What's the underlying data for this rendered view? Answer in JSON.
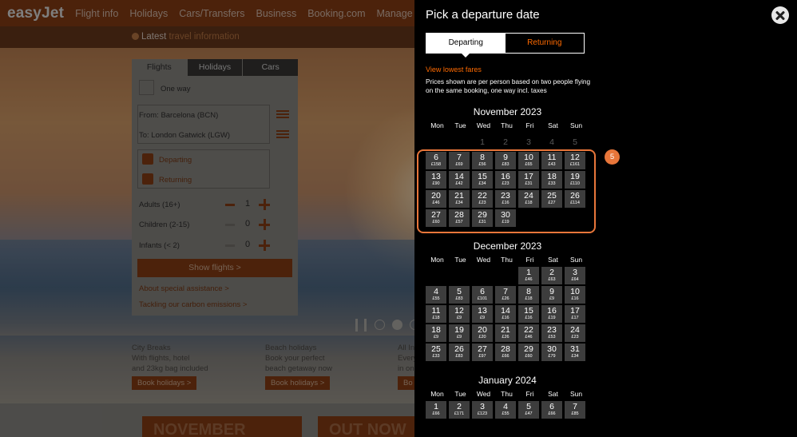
{
  "header": {
    "logo": "easyJet",
    "nav": [
      "Flight info",
      "Holidays",
      "Cars/Transfers",
      "Business",
      "Booking.com",
      "Manage Bookin"
    ]
  },
  "infobar": {
    "prefix": "Latest",
    "link": "travel information"
  },
  "search": {
    "tabs": [
      "Flights",
      "Holidays",
      "Cars"
    ],
    "one_way": "One way",
    "from": "From:  Barcelona (BCN)",
    "to": "To:  London Gatwick (LGW)",
    "departing": "Departing",
    "returning": "Returning",
    "passengers": [
      {
        "label": "Adults (16+)",
        "value": "1"
      },
      {
        "label": "Children (2-15)",
        "value": "0"
      },
      {
        "label": "Infants (< 2)",
        "value": "0"
      }
    ],
    "show_button": "Show flights >",
    "links": [
      "About special assistance >",
      "Tackling our carbon emissions >"
    ]
  },
  "promos": [
    {
      "title": "City Breaks",
      "line1": "With flights, hotel",
      "line2": "and 23kg bag included",
      "button": "Book holidays >"
    },
    {
      "title": "Beach holidays",
      "line1": "Book your perfect",
      "line2": "beach getaway now",
      "button": "Book holidays >"
    },
    {
      "title": "All In",
      "line1": "Every",
      "line2": "in one",
      "button": "Bo"
    }
  ],
  "bottom_cards": [
    "NOVEMBER",
    "OUT NOW"
  ],
  "modal": {
    "title": "Pick a departure date",
    "toggle": {
      "departing": "Departing",
      "returning": "Returning"
    },
    "lowest_fares": "View lowest fares",
    "note": "Prices shown are per person based on two people flying on the same booking, one way incl. taxes",
    "step_badge": "5",
    "weekdays": [
      "Mon",
      "Tue",
      "Wed",
      "Thu",
      "Fri",
      "Sat",
      "Sun"
    ],
    "months": [
      {
        "name": "November 2023",
        "leading": [
          "",
          "",
          "1",
          "2",
          "3",
          "4",
          "5"
        ],
        "days": [
          {
            "d": "6",
            "p": "£158"
          },
          {
            "d": "7",
            "p": "£69"
          },
          {
            "d": "8",
            "p": "£56"
          },
          {
            "d": "9",
            "p": "£83"
          },
          {
            "d": "10",
            "p": "£65"
          },
          {
            "d": "11",
            "p": "£43"
          },
          {
            "d": "12",
            "p": "£161"
          },
          {
            "d": "13",
            "p": "£90"
          },
          {
            "d": "14",
            "p": "£42"
          },
          {
            "d": "15",
            "p": "£34"
          },
          {
            "d": "16",
            "p": "£23"
          },
          {
            "d": "17",
            "p": "£31"
          },
          {
            "d": "18",
            "p": "£33"
          },
          {
            "d": "19",
            "p": "£110"
          },
          {
            "d": "20",
            "p": "£46"
          },
          {
            "d": "21",
            "p": "£34"
          },
          {
            "d": "22",
            "p": "£23"
          },
          {
            "d": "23",
            "p": "£16"
          },
          {
            "d": "24",
            "p": "£18"
          },
          {
            "d": "25",
            "p": "£27"
          },
          {
            "d": "26",
            "p": "£114"
          },
          {
            "d": "27",
            "p": "£60"
          },
          {
            "d": "28",
            "p": "£57"
          },
          {
            "d": "29",
            "p": "£31"
          },
          {
            "d": "30",
            "p": "£19"
          }
        ]
      },
      {
        "name": "December 2023",
        "offset": 4,
        "days": [
          {
            "d": "1",
            "p": "£46"
          },
          {
            "d": "2",
            "p": "£63"
          },
          {
            "d": "3",
            "p": "£64"
          },
          {
            "d": "4",
            "p": "£55"
          },
          {
            "d": "5",
            "p": "£83"
          },
          {
            "d": "6",
            "p": "£101"
          },
          {
            "d": "7",
            "p": "£26"
          },
          {
            "d": "8",
            "p": "£18"
          },
          {
            "d": "9",
            "p": "£9"
          },
          {
            "d": "10",
            "p": "£16"
          },
          {
            "d": "11",
            "p": "£18"
          },
          {
            "d": "12",
            "p": "£9"
          },
          {
            "d": "13",
            "p": "£9"
          },
          {
            "d": "14",
            "p": "£16"
          },
          {
            "d": "15",
            "p": "£16"
          },
          {
            "d": "16",
            "p": "£19"
          },
          {
            "d": "17",
            "p": "£17"
          },
          {
            "d": "18",
            "p": "£9"
          },
          {
            "d": "19",
            "p": "£9"
          },
          {
            "d": "20",
            "p": "£20"
          },
          {
            "d": "21",
            "p": "£26"
          },
          {
            "d": "22",
            "p": "£46"
          },
          {
            "d": "23",
            "p": "£53"
          },
          {
            "d": "24",
            "p": "£23"
          },
          {
            "d": "25",
            "p": "£33"
          },
          {
            "d": "26",
            "p": "£83"
          },
          {
            "d": "27",
            "p": "£97"
          },
          {
            "d": "28",
            "p": "£66"
          },
          {
            "d": "29",
            "p": "£60"
          },
          {
            "d": "30",
            "p": "£79"
          },
          {
            "d": "31",
            "p": "£34"
          }
        ]
      },
      {
        "name": "January 2024",
        "offset": 0,
        "days": [
          {
            "d": "1",
            "p": "£66"
          },
          {
            "d": "2",
            "p": "£171"
          },
          {
            "d": "3",
            "p": "£123"
          },
          {
            "d": "4",
            "p": "£55"
          },
          {
            "d": "5",
            "p": "£47"
          },
          {
            "d": "6",
            "p": "£66"
          },
          {
            "d": "7",
            "p": "£85"
          }
        ]
      }
    ]
  },
  "colors": {
    "accent": "#ff6a00",
    "highlight": "#e8763a",
    "cell": "#3d3d3d"
  }
}
